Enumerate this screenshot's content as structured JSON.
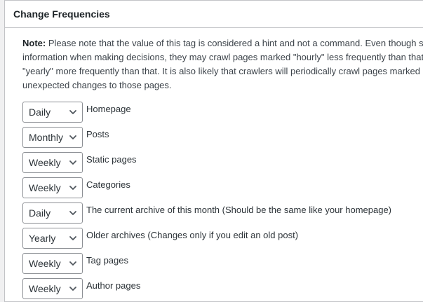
{
  "panel": {
    "title": "Change Frequencies"
  },
  "note": {
    "prefix": "Note:",
    "line1": " Please note that the value of this tag is considered a hint and not a command. Even though se",
    "line2": "information when making decisions, they may crawl pages marked \"hourly\" less frequently than that",
    "line3": "\"yearly\" more frequently than that. It is also likely that crawlers will periodically crawl pages marked \"",
    "line4": "unexpected changes to those pages."
  },
  "rows": [
    {
      "value": "Daily",
      "label": "Homepage"
    },
    {
      "value": "Monthly",
      "label": "Posts"
    },
    {
      "value": "Weekly",
      "label": "Static pages"
    },
    {
      "value": "Weekly",
      "label": "Categories"
    },
    {
      "value": "Daily",
      "label": "The current archive of this month (Should be the same like your homepage)"
    },
    {
      "value": "Yearly",
      "label": "Older archives (Changes only if you edit an old post)"
    },
    {
      "value": "Weekly",
      "label": "Tag pages"
    },
    {
      "value": "Weekly",
      "label": "Author pages"
    }
  ],
  "icons": {
    "select_arrow": "chevron-down-icon"
  }
}
